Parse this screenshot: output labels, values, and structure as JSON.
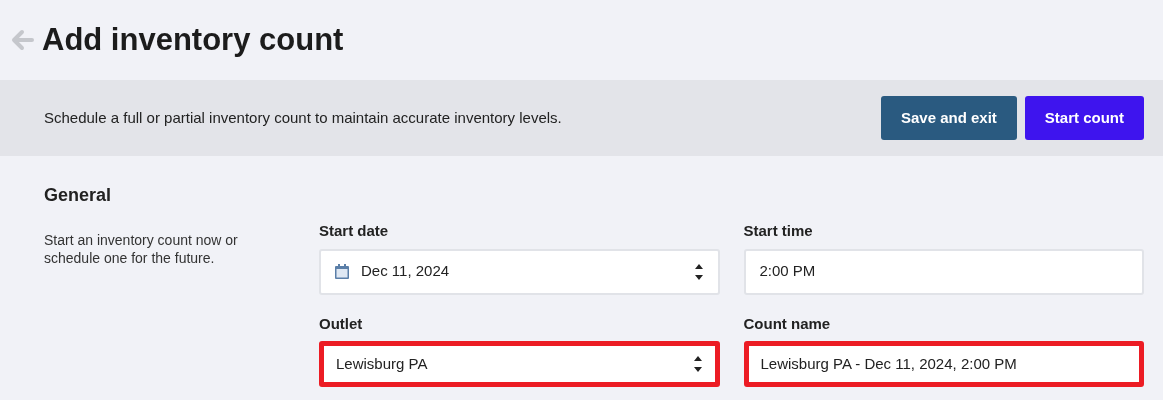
{
  "header": {
    "title": "Add inventory count"
  },
  "banner": {
    "text": "Schedule a full or partial inventory count to maintain accurate inventory levels.",
    "buttons": [
      {
        "label": "Save and exit",
        "kind": "secondary"
      },
      {
        "label": "Start count",
        "kind": "primary"
      }
    ]
  },
  "section": {
    "title": "General",
    "description": "Start an inventory count now or schedule one for the future.",
    "fields": [
      {
        "label": "Start date",
        "value": "Dec 11, 2024",
        "kind": "date",
        "highlighted": false
      },
      {
        "label": "Start time",
        "value": "2:00 PM",
        "kind": "text",
        "highlighted": false
      },
      {
        "label": "Outlet",
        "value": "Lewisburg PA",
        "kind": "select",
        "highlighted": true
      },
      {
        "label": "Count name",
        "value": "Lewisburg PA - Dec 11, 2024, 2:00 PM",
        "kind": "text",
        "highlighted": true
      }
    ]
  }
}
